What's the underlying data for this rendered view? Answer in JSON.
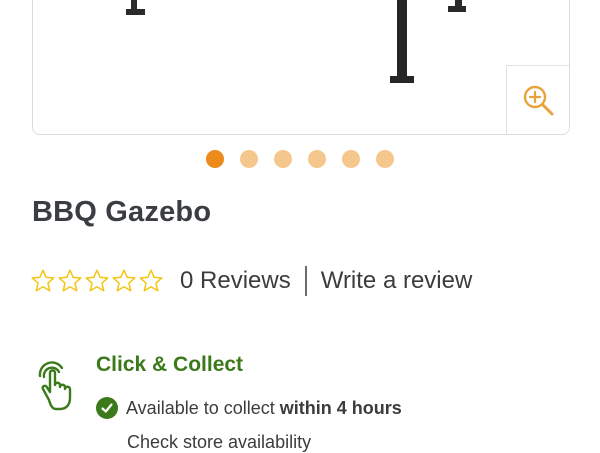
{
  "gallery": {
    "slide_count": 6,
    "active_slide": 1,
    "zoom_icon": "zoom-in-icon"
  },
  "product": {
    "title": "BBQ Gazebo"
  },
  "rating": {
    "stars_filled": 0,
    "stars_total": 5,
    "reviews_label": "0 Reviews",
    "write_review_label": "Write a review"
  },
  "click_collect": {
    "icon": "tap-hand-icon",
    "title": "Click & Collect",
    "availability_prefix": "Available to collect",
    "availability_time": "within 4 hours",
    "check_store_label": "Check store availability"
  },
  "colors": {
    "accent_orange": "#ec8a1c",
    "dot_inactive": "#f6c78d",
    "star_yellow": "#f2c617",
    "brand_green": "#3b7a1a",
    "text_dark": "#3c3c3c"
  }
}
